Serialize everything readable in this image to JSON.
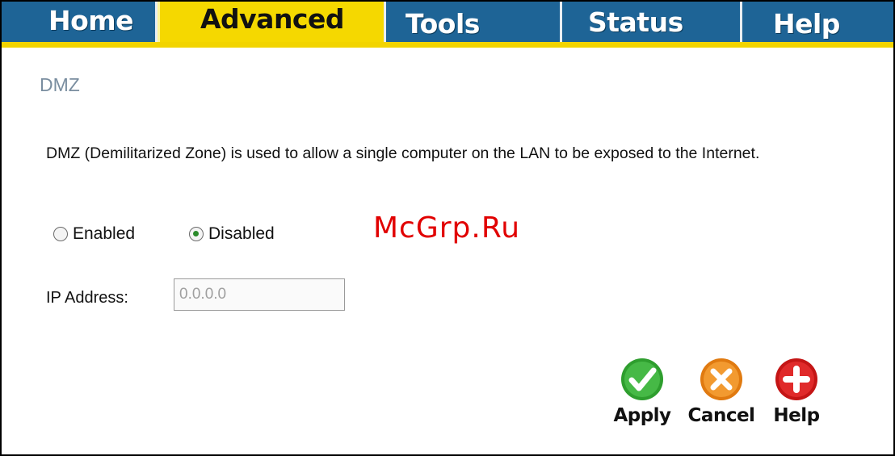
{
  "nav": {
    "tabs": [
      {
        "label": "Home"
      },
      {
        "label": "Advanced"
      },
      {
        "label": "Tools"
      },
      {
        "label": "Status"
      },
      {
        "label": "Help"
      }
    ],
    "active_tab": "Advanced"
  },
  "page": {
    "title": "DMZ",
    "description": "DMZ (Demilitarized Zone) is used to allow a single computer on the LAN to be exposed to the Internet."
  },
  "dmz": {
    "enabled_label": "Enabled",
    "disabled_label": "Disabled",
    "selected": "Disabled",
    "ip_label": "IP Address:",
    "ip_value": "0.0.0.0"
  },
  "watermark": "McGrp.Ru",
  "actions": {
    "apply_label": "Apply",
    "cancel_label": "Cancel",
    "help_label": "Help"
  },
  "icons": {
    "apply": "check-icon",
    "cancel": "x-icon",
    "help": "plus-icon"
  },
  "colors": {
    "nav_bg": "#1e6496",
    "nav_accent": "#f5d800",
    "title": "#7a8ea0",
    "apply": "#2e9e2e",
    "cancel": "#f08a1c",
    "help": "#d81e1e",
    "watermark": "#e10000"
  }
}
